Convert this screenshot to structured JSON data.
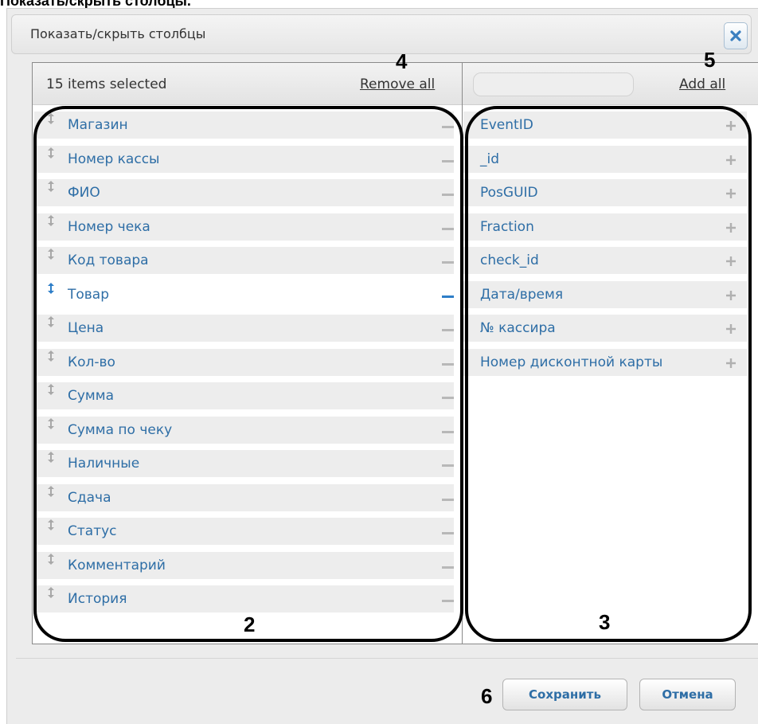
{
  "doc_heading": "Показать/скрыть столбцы.",
  "dialog": {
    "title": "Показать/скрыть столбцы",
    "close_icon": "close-x-icon"
  },
  "left_panel": {
    "count_text": "15 items selected",
    "remove_all": "Remove all",
    "items": [
      "Магазин",
      "Номер кассы",
      "ФИО",
      "Номер чека",
      "Код товара",
      "Товар",
      "Цена",
      "Кол-во",
      "Сумма",
      "Сумма по чеку",
      "Наличные",
      "Сдача",
      "Статус",
      "Комментарий",
      "История"
    ],
    "highlighted_item": "Товар"
  },
  "right_panel": {
    "search_value": "",
    "add_all": "Add all",
    "items": [
      "EventID",
      "_id",
      "PosGUID",
      "Fraction",
      "check_id",
      "Дата/время",
      "№ кассира",
      "Номер дисконтной карты"
    ]
  },
  "annotations": {
    "n2": "2",
    "n3": "3",
    "n4": "4",
    "n5": "5",
    "n6": "6"
  },
  "buttons": {
    "save": "Сохранить",
    "cancel": "Отмена"
  },
  "colors": {
    "item_text": "#2e6ea6",
    "accent": "#2e7ec8"
  }
}
